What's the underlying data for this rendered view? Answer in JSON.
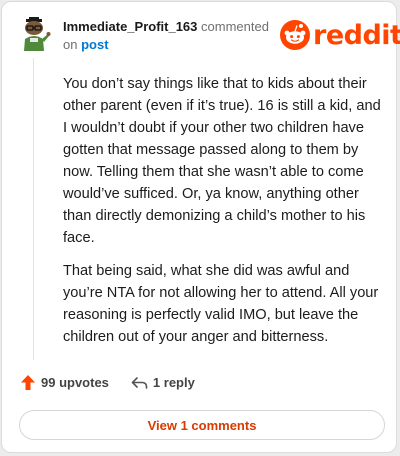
{
  "header": {
    "username": "Immediate_Profit_163",
    "commented_text": "commented",
    "on_text": "on",
    "post_link": "post",
    "logo_text": "reddit"
  },
  "comment": {
    "paragraphs": [
      "You don’t say things like that to kids about their other parent (even if it’s true). 16 is still a kid, and I wouldn’t doubt if your other two children have gotten that message passed along to them by now. Telling them that she wasn’t able to come would’ve sufficed. Or, ya know, anything other than directly demonizing a child’s mother to his face.",
      "That being said, what she did was awful and you’re NTA for not allowing her to attend. All your reasoning is perfectly valid IMO, but leave the children out of your anger and bitterness."
    ]
  },
  "actions": {
    "upvotes_label": "99 upvotes",
    "reply_label": "1 reply"
  },
  "view_comments_label": "View 1 comments",
  "colors": {
    "brand": "#ff4500",
    "link": "#0079d3",
    "view_button_text": "#d93a00"
  },
  "icons": {
    "avatar": "snoo-avatar",
    "logo": "reddit-snoo-icon",
    "upvote": "upvote-arrow-icon",
    "reply": "reply-arrow-icon"
  }
}
